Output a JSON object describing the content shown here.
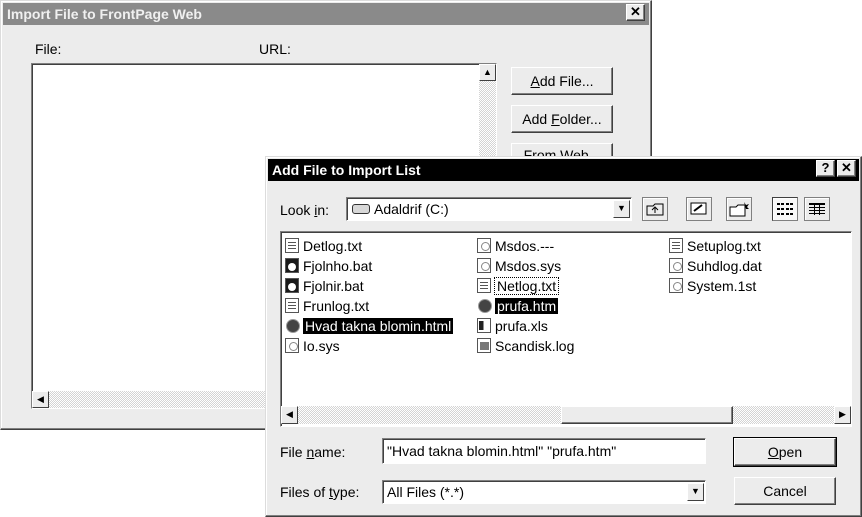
{
  "import_window": {
    "title": "Import File to FrontPage Web",
    "close_glyph": "✕",
    "file_column_label": "File:",
    "url_column_label": "URL:",
    "add_file_button": "Add File...",
    "add_file_mnemonic": "A",
    "add_folder_button": "Add Folder...",
    "add_folder_mnemonic": "F",
    "hidden_button_partial": "From Web..."
  },
  "dialog": {
    "title": "Add File to Import List",
    "help_glyph": "?",
    "close_glyph": "✕",
    "look_in_label": "Look in:",
    "look_in_mnemonic": "i",
    "look_in_value": "Adaldrif (C:)",
    "toolbar": [
      "up-one-level-icon",
      "desktop-icon",
      "new-folder-icon",
      "list-view-icon",
      "details-view-icon"
    ],
    "files": [
      {
        "name": "Detlog.txt",
        "icon": "text-file-icon",
        "selected": false,
        "focused": false
      },
      {
        "name": "Fjolnho.bat",
        "icon": "batch-file-icon",
        "selected": false,
        "focused": false
      },
      {
        "name": "Fjolnir.bat",
        "icon": "batch-file-icon",
        "selected": false,
        "focused": false
      },
      {
        "name": "Frunlog.txt",
        "icon": "text-file-icon",
        "selected": false,
        "focused": false
      },
      {
        "name": "Hvad takna blomin.html",
        "icon": "html-file-icon",
        "selected": true,
        "focused": false
      },
      {
        "name": "Io.sys",
        "icon": "system-file-icon",
        "selected": false,
        "focused": false
      },
      {
        "name": "Msdos.---",
        "icon": "generic-file-icon",
        "selected": false,
        "focused": false
      },
      {
        "name": "Msdos.sys",
        "icon": "system-file-icon",
        "selected": false,
        "focused": false
      },
      {
        "name": "Netlog.txt",
        "icon": "text-file-icon",
        "selected": false,
        "focused": true
      },
      {
        "name": "prufa.htm",
        "icon": "html-file-icon",
        "selected": true,
        "focused": false
      },
      {
        "name": "prufa.xls",
        "icon": "excel-file-icon",
        "selected": false,
        "focused": false
      },
      {
        "name": "Scandisk.log",
        "icon": "log-file-icon",
        "selected": false,
        "focused": false
      },
      {
        "name": "Setuplog.txt",
        "icon": "text-file-icon",
        "selected": false,
        "focused": false
      },
      {
        "name": "Suhdlog.dat",
        "icon": "generic-file-icon",
        "selected": false,
        "focused": false
      },
      {
        "name": "System.1st",
        "icon": "generic-file-icon",
        "selected": false,
        "focused": false
      }
    ],
    "file_name_label": "File name:",
    "file_name_mnemonic": "n",
    "file_name_value": "\"Hvad takna blomin.html\" \"prufa.htm\"",
    "files_of_type_label": "Files of type:",
    "files_of_type_mnemonic": "t",
    "files_of_type_value": "All Files (*.*)",
    "open_button": "Open",
    "open_mnemonic": "O",
    "cancel_button": "Cancel"
  }
}
